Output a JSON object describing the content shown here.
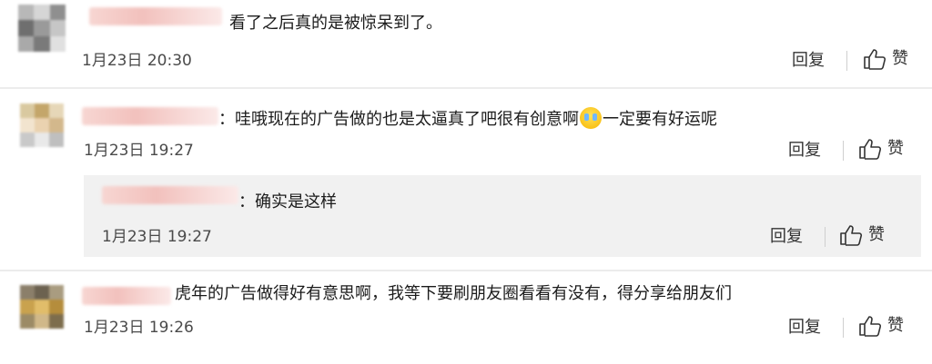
{
  "actions": {
    "reply": "回复",
    "like": "赞"
  },
  "comments": [
    {
      "text": "看了之后真的是被惊呆到了。",
      "time": "1月23日 20:30"
    },
    {
      "text_a": "：哇哦现在的广告做的也是太逼真了吧很有创意啊",
      "text_b": "一定要有好运呢",
      "time": "1月23日 19:27",
      "reply": {
        "text": "：确实是这样",
        "time": "1月23日 19:27"
      }
    },
    {
      "text": "虎年的广告做得好有意思啊，我等下要刷朋友圈看看有没有，得分享给朋友们",
      "time": "1月23日 19:26"
    }
  ],
  "colors": {
    "name_blur": "#f2c1bd",
    "reply_bg": "#f1f1f1",
    "divider": "#ececec"
  },
  "icons": [
    "thumbs-up-icon",
    "crying-laugh-emoji"
  ]
}
